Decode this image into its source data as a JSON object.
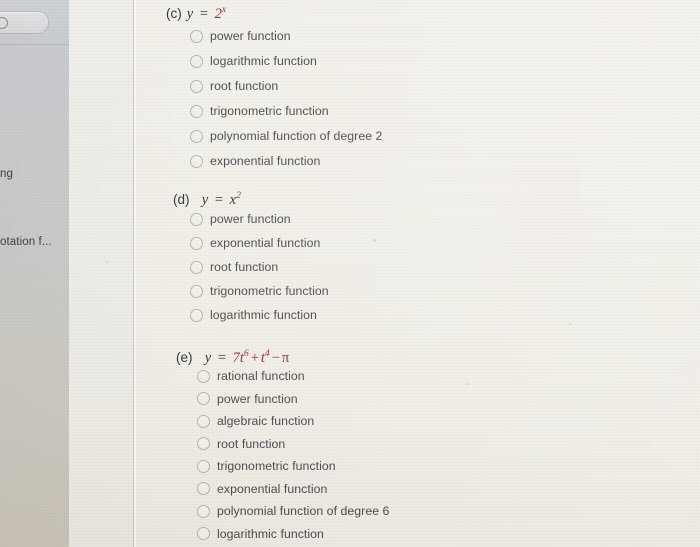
{
  "window": {
    "background_color": "#efece5",
    "panel_color": "#c9c8c6"
  },
  "sidebar": {
    "search_box": {
      "name": "search-box",
      "icon": "search-icon",
      "value": ""
    },
    "items": [
      {
        "label": "ng",
        "truncated": true
      },
      {
        "label": "otation f...",
        "truncated": true
      }
    ]
  },
  "content": {
    "questions": [
      {
        "id": "c",
        "label": "(c)",
        "expression_parts": [
          {
            "text": "y",
            "style": "var"
          },
          {
            "text": "=",
            "style": "eq"
          },
          {
            "text": "2",
            "style": "hot"
          },
          {
            "text": "x",
            "style": "hot-sup"
          }
        ],
        "expression_plain": "y = 2^x",
        "options": [
          "power function",
          "logarithmic function",
          "root function",
          "trigonometric function",
          "polynomial function of degree 2",
          "exponential function"
        ],
        "selected": null
      },
      {
        "id": "d",
        "label": "(d)",
        "expression_parts": [
          {
            "text": "y",
            "style": "var"
          },
          {
            "text": "=",
            "style": "eq"
          },
          {
            "text": "x",
            "style": "var"
          },
          {
            "text": "2",
            "style": "hot-sup"
          }
        ],
        "expression_plain": "y = x^2",
        "options": [
          "power function",
          "exponential function",
          "root function",
          "trigonometric function",
          "logarithmic function"
        ],
        "selected": null
      },
      {
        "id": "e",
        "label": "(e)",
        "expression_parts": [
          {
            "text": "y",
            "style": "var"
          },
          {
            "text": "=",
            "style": "eq"
          },
          {
            "text": "7t",
            "style": "hot"
          },
          {
            "text": "6",
            "style": "hot-sup"
          },
          {
            "text": "+",
            "style": "op"
          },
          {
            "text": "t",
            "style": "hot"
          },
          {
            "text": "4",
            "style": "hot-sup"
          },
          {
            "text": "−",
            "style": "op"
          },
          {
            "text": "π",
            "style": "hot"
          }
        ],
        "expression_plain": "y = 7t^6 + t^4 − π",
        "options": [
          "rational function",
          "power function",
          "algebraic function",
          "root function",
          "trigonometric function",
          "exponential function",
          "polynomial function of degree 6",
          "logarithmic function"
        ],
        "selected": null
      }
    ]
  },
  "colors": {
    "expression_accent": "#9d2933",
    "option_text": "#4a4a4c",
    "stem_text": "#2f3236"
  }
}
